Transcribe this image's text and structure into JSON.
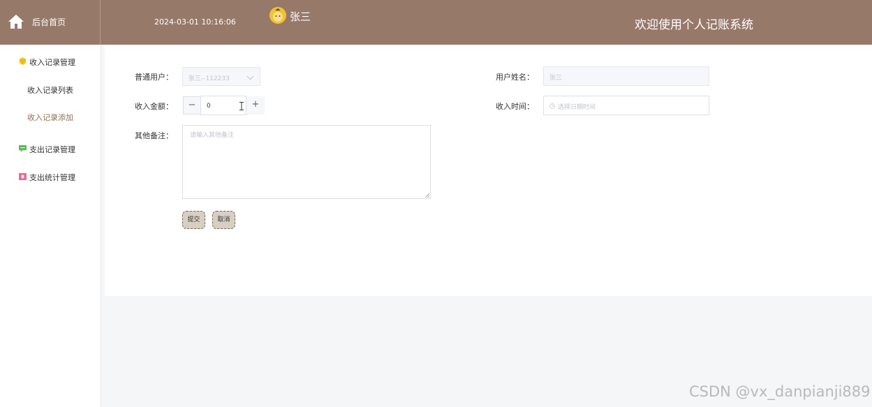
{
  "header": {
    "home_label": "后台首页",
    "datetime": "2024-03-01 10:16:06",
    "username": "张三",
    "system_title": "欢迎使用个人记账系统"
  },
  "sidebar": {
    "groups": [
      {
        "label": "收入记录管理",
        "icon": "cube-icon",
        "color": "#f5c518"
      },
      {
        "label": "支出记录管理",
        "icon": "message-icon",
        "color": "#5cb85c"
      },
      {
        "label": "支出统计管理",
        "icon": "gift-icon",
        "color": "#e8699a"
      }
    ],
    "subitems": [
      {
        "label": "收入记录列表"
      },
      {
        "label": "收入记录添加",
        "active": true
      }
    ]
  },
  "form": {
    "user_label": "普通用户：",
    "user_value": "张三--112233",
    "name_label": "用户姓名：",
    "name_value": "张三",
    "amount_label": "收入金额：",
    "amount_value": "0",
    "minus": "−",
    "plus": "+",
    "time_label": "收入时间：",
    "time_placeholder": "选择日期时间",
    "remark_label": "其他备注：",
    "remark_placeholder": "请输入其他备注",
    "submit_label": "提交",
    "cancel_label": "取消"
  },
  "watermark": "CSDN @vx_danpianji889",
  "colors": {
    "header_bg": "#97796a",
    "active_menu": "#8d6e54",
    "button_bg": "#d8cfc3"
  }
}
